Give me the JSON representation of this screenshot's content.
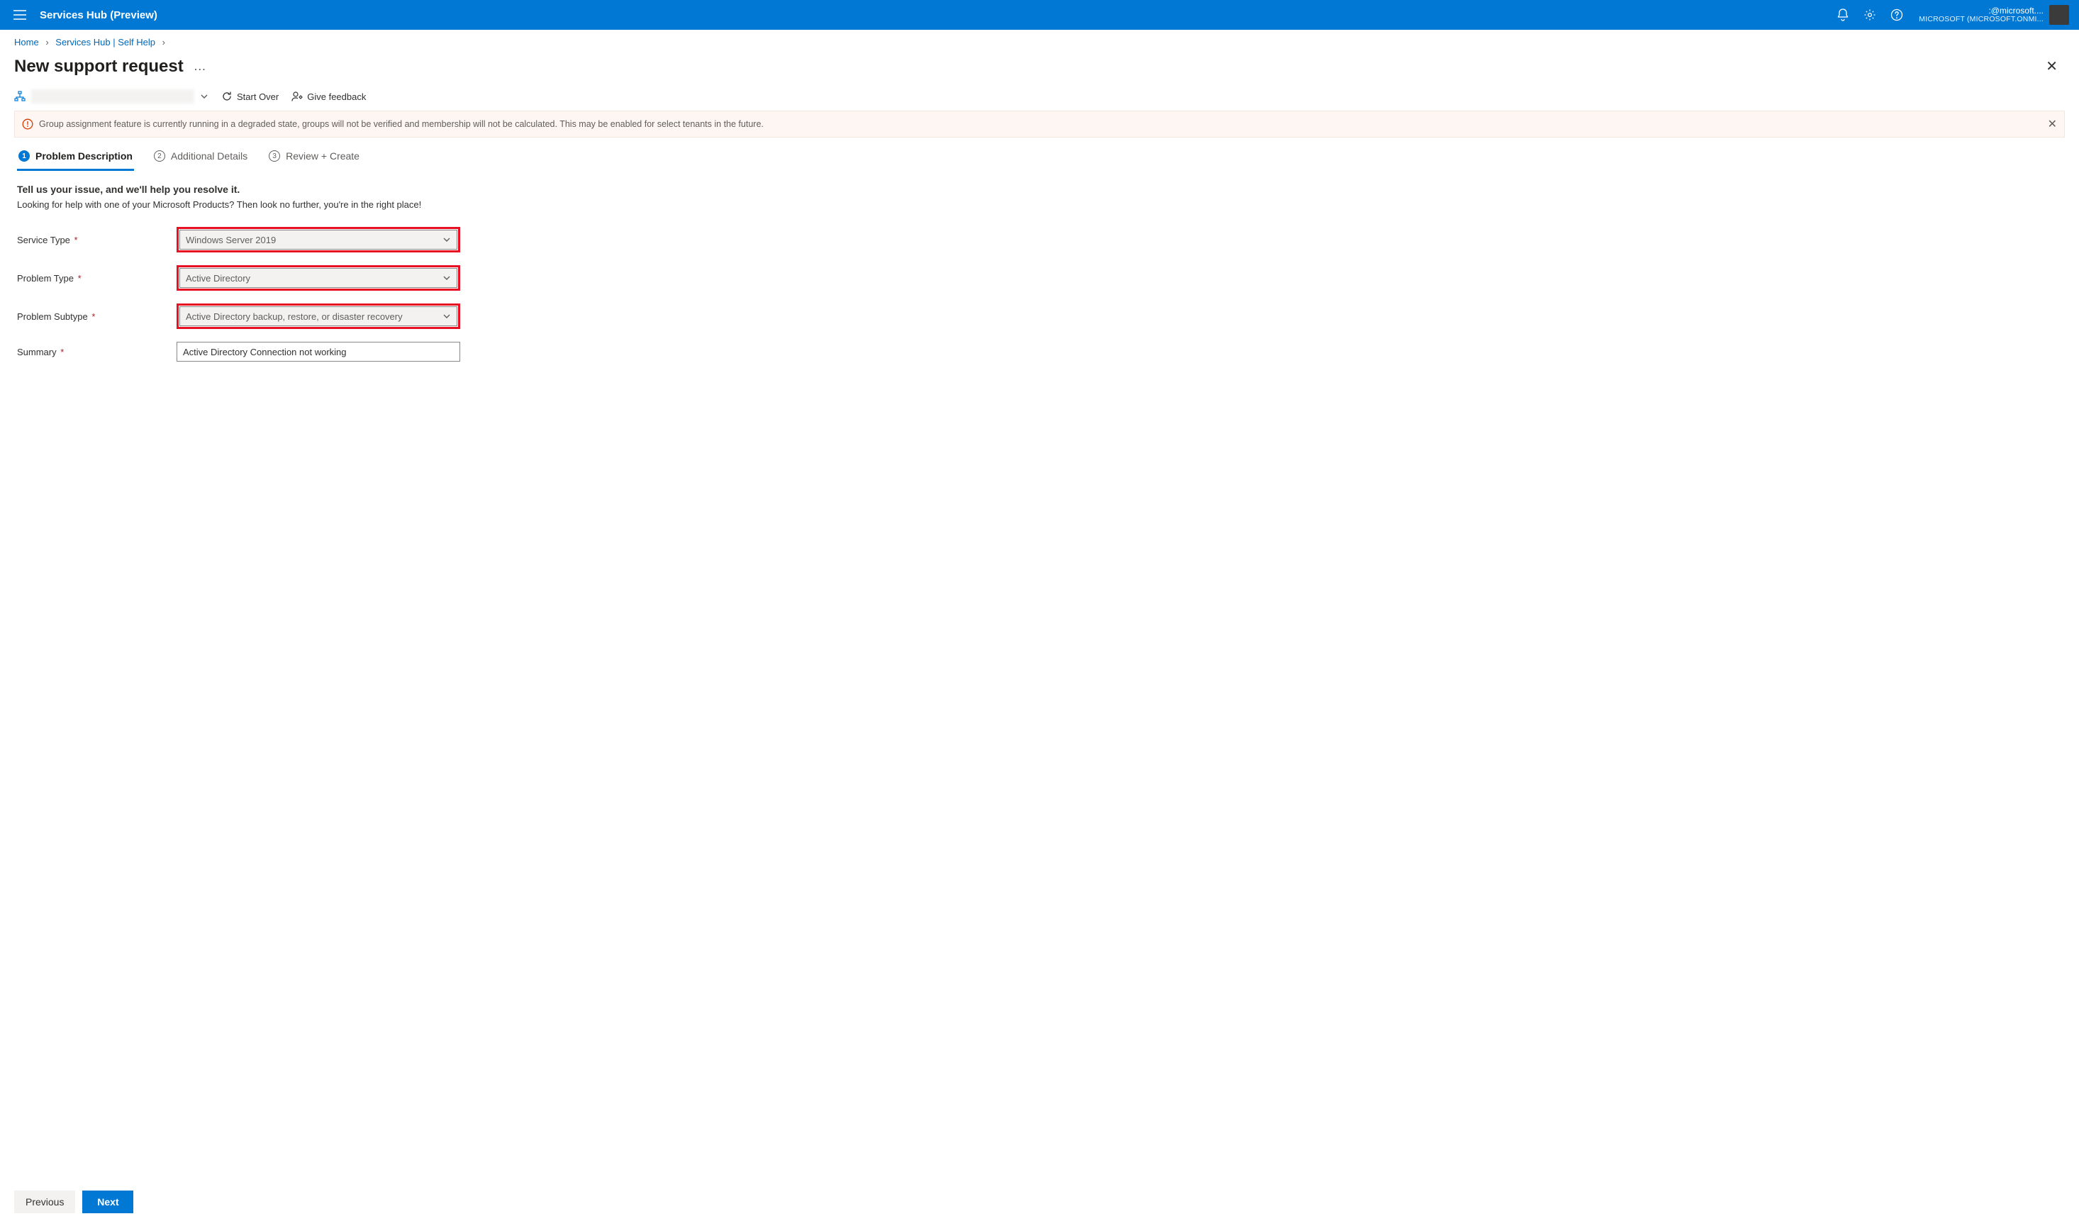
{
  "topbar": {
    "title": "Services Hub (Preview)",
    "account_primary": ":@microsoft....",
    "account_secondary": "MICROSOFT (MICROSOFT.ONMI..."
  },
  "breadcrumb": {
    "items": [
      "Home",
      "Services Hub | Self Help"
    ]
  },
  "page": {
    "title": "New support request"
  },
  "toolbar": {
    "start_over": "Start Over",
    "give_feedback": "Give feedback"
  },
  "alert": {
    "text": "Group assignment feature is currently running in a degraded state, groups will not be verified and membership will not be calculated. This may be enabled for select tenants in the future."
  },
  "tabs": {
    "t1": {
      "num": "1",
      "label": "Problem Description"
    },
    "t2": {
      "num": "2",
      "label": "Additional Details"
    },
    "t3": {
      "num": "3",
      "label": "Review + Create"
    }
  },
  "form": {
    "lead": "Tell us your issue, and we'll help you resolve it.",
    "sublead": "Looking for help with one of your Microsoft Products? Then look no further, you're in the right place!",
    "service_type": {
      "label": "Service Type",
      "value": "Windows Server 2019"
    },
    "problem_type": {
      "label": "Problem Type",
      "value": "Active Directory"
    },
    "problem_subtype": {
      "label": "Problem Subtype",
      "value": "Active Directory backup, restore, or disaster recovery"
    },
    "summary": {
      "label": "Summary",
      "value": "Active Directory Connection not working"
    }
  },
  "footer": {
    "previous": "Previous",
    "next": "Next"
  }
}
